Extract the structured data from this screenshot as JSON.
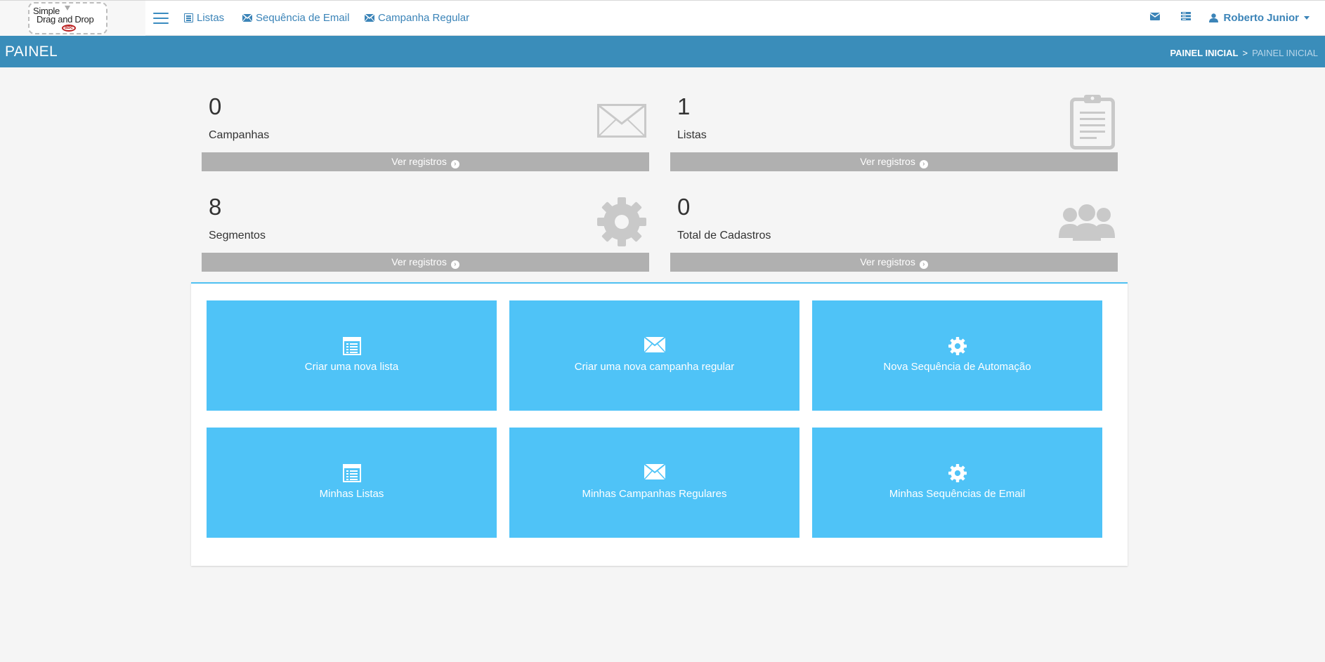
{
  "logo": {
    "line1": "Simple",
    "line2": "Drag and Drop",
    "mark": "abc"
  },
  "nav": {
    "links": [
      {
        "label": "Listas",
        "icon": "list-icon"
      },
      {
        "label": "Sequência de Email",
        "icon": "envelope-icon"
      },
      {
        "label": "Campanha Regular",
        "icon": "envelope-icon"
      }
    ],
    "user_name": "Roberto Junior"
  },
  "titlebar": {
    "title": "PAINEL",
    "breadcrumb": {
      "home": "PAINEL INICIAL",
      "separator": ">",
      "current": "PAINEL INICIAL"
    }
  },
  "stats": [
    {
      "value": "0",
      "label": "Campanhas",
      "link": "Ver registros",
      "icon": "envelope-icon"
    },
    {
      "value": "1",
      "label": "Listas",
      "link": "Ver registros",
      "icon": "clipboard-icon"
    },
    {
      "value": "8",
      "label": "Segmentos",
      "link": "Ver registros",
      "icon": "gear-icon"
    },
    {
      "value": "0",
      "label": "Total de Cadastros",
      "link": "Ver registros",
      "icon": "users-icon"
    }
  ],
  "tiles": [
    {
      "label": "Criar uma nova lista",
      "icon": "list-icon"
    },
    {
      "label": "Criar uma nova campanha regular",
      "icon": "envelope-icon"
    },
    {
      "label": "Nova Sequência de Automação",
      "icon": "gear-icon"
    },
    {
      "label": "Minhas Listas",
      "icon": "list-icon"
    },
    {
      "label": "Minhas Campanhas Regulares",
      "icon": "envelope-icon"
    },
    {
      "label": "Minhas Sequências de Email",
      "icon": "gear-icon"
    }
  ],
  "colors": {
    "nav_text": "#3b84b8",
    "titlebar": "#3a8dba",
    "tile": "#4fc3f7",
    "stat_footer": "#b0b0b0"
  }
}
